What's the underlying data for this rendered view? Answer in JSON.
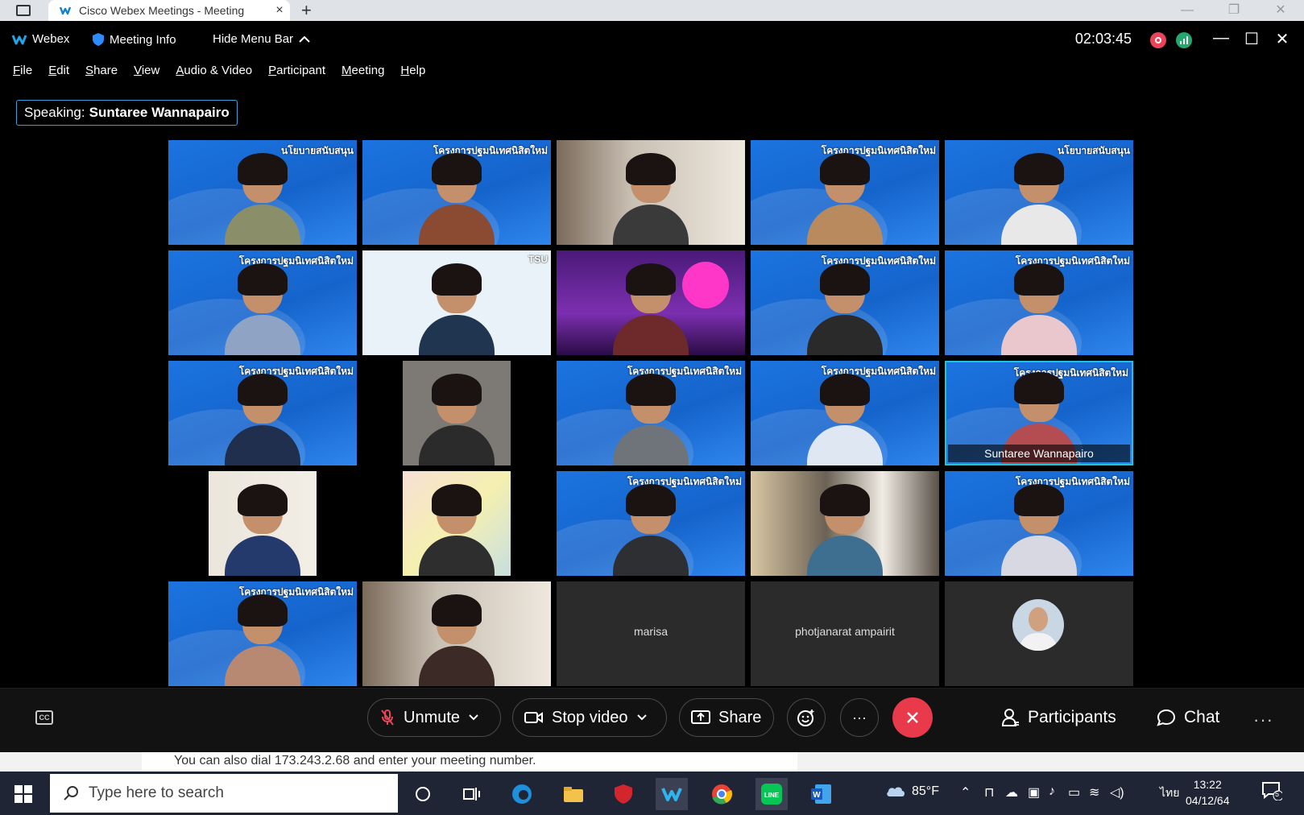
{
  "browser": {
    "tab_title": "Cisco Webex Meetings - Meeting",
    "tab_close": "×",
    "new_tab": "+"
  },
  "titlebar": {
    "app_name": "Webex",
    "meeting_info": "Meeting Info",
    "hide_menu_bar": "Hide Menu Bar",
    "timer": "02:03:45"
  },
  "menu": [
    "File",
    "Edit",
    "Share",
    "View",
    "Audio & Video",
    "Participant",
    "Meeting",
    "Help"
  ],
  "speaking": {
    "label": "Speaking:",
    "name": "Suntaree Wannapairo"
  },
  "tiles": [
    {
      "style": "bgd",
      "banner": "นโยบายสนับสนุน",
      "shirt": "#8a8f6a"
    },
    {
      "style": "bgd",
      "banner": "โครงการปฐมนิเทศนิสิตใหม่",
      "shirt": "#8b4a32"
    },
    {
      "style": "room",
      "banner": "",
      "shirt": "#3a3a3a"
    },
    {
      "style": "bgd",
      "banner": "โครงการปฐมนิเทศนิสิตใหม่",
      "shirt": "#b98a5d"
    },
    {
      "style": "bgd",
      "banner": "นโยบายสนับสนุน",
      "shirt": "#e8e8e8"
    },
    {
      "style": "bgd",
      "banner": "โครงการปฐมนิเทศนิสิตใหม่",
      "shirt": "#8fa3c4"
    },
    {
      "style": "tsu",
      "banner": "TSU",
      "shirt": "#1f3550"
    },
    {
      "style": "neon",
      "banner": "",
      "shirt": "#6e2a2a"
    },
    {
      "style": "bgd",
      "banner": "โครงการปฐมนิเทศนิสิตใหม่",
      "shirt": "#2a2a2a"
    },
    {
      "style": "bgd",
      "banner": "โครงการปฐมนิเทศนิสิตใหม่",
      "shirt": "#e9c7cc"
    },
    {
      "style": "bgd",
      "banner": "โครงการปฐมนิเทศนิสิตใหม่",
      "shirt": "#1f2f4d"
    },
    {
      "style": "pillar",
      "banner": "",
      "shirt": "#2b2b2b"
    },
    {
      "style": "bgd",
      "banner": "โครงการปฐมนิเทศนิสิตใหม่",
      "shirt": "#6e747a"
    },
    {
      "style": "bgd",
      "banner": "โครงการปฐมนิเทศนิสิตใหม่",
      "shirt": "#dfe7f2"
    },
    {
      "style": "bgd",
      "banner": "โครงการปฐมนิเทศนิสิตใหม่",
      "shirt": "#b34d52",
      "name": "Suntaree Wannapairo",
      "active": true
    },
    {
      "style": "pillar-room",
      "banner": "",
      "shirt": "#243a6d"
    },
    {
      "style": "pillar-pink",
      "banner": "",
      "shirt": "#2e2e2e"
    },
    {
      "style": "bgd",
      "banner": "โครงการปฐมนิเทศนิสิตใหม่",
      "shirt": "#2d2f33"
    },
    {
      "style": "window",
      "banner": "",
      "shirt": "#3e6f91"
    },
    {
      "style": "bgd",
      "banner": "โครงการปฐมนิเทศนิสิตใหม่",
      "shirt": "#d8d8e2"
    },
    {
      "style": "bgd",
      "banner": "โครงการปฐมนิเทศนิสิตใหม่",
      "shirt": "#b88972"
    },
    {
      "style": "room",
      "banner": "",
      "shirt": "#3b2a25"
    },
    {
      "style": "empty",
      "label": "marisa"
    },
    {
      "style": "empty",
      "label": "photjanarat ampairit"
    },
    {
      "style": "avatar"
    }
  ],
  "controls": {
    "cc": "CC",
    "unmute": "Unmute",
    "stop_video": "Stop video",
    "share": "Share",
    "more": "···",
    "participants": "Participants",
    "chat": "Chat",
    "overflow": "···"
  },
  "dial_text": "You can also dial 173.243.2.68 and enter your meeting number.",
  "taskbar": {
    "search_placeholder": "Type here to search",
    "temperature": "85°F",
    "language": "ไทย",
    "time": "13:22",
    "date": "04/12/64",
    "notification_count": "5"
  },
  "colors": {
    "accent_blue": "#1fc3e0",
    "leave_red": "#e83a4a",
    "record_red": "#e9445a",
    "network_green": "#25a86b"
  }
}
